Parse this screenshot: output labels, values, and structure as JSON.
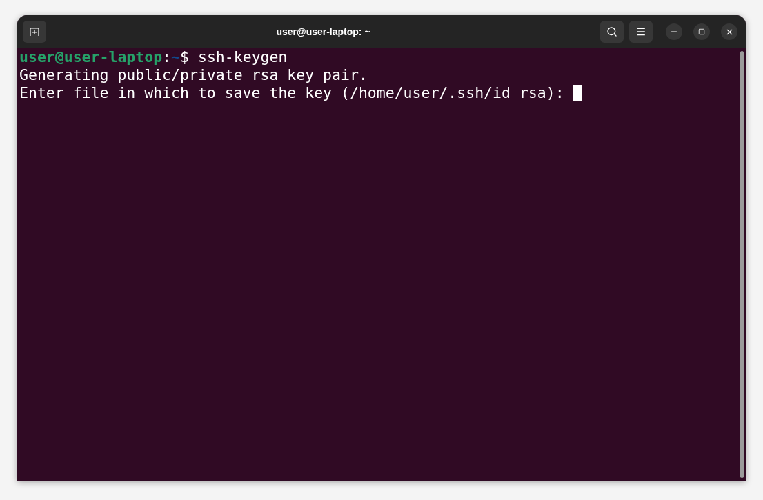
{
  "window": {
    "title": "user@user-laptop: ~"
  },
  "terminal": {
    "prompt": {
      "user_host": "user@user-laptop",
      "separator": ":",
      "path": "~",
      "symbol": "$",
      "command": "ssh-keygen"
    },
    "output": [
      "Generating public/private rsa key pair.",
      "Enter file in which to save the key (/home/user/.ssh/id_rsa): "
    ],
    "cursor": true
  }
}
